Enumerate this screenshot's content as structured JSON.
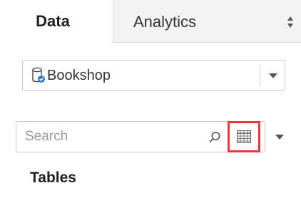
{
  "tabs": {
    "data_label": "Data",
    "analytics_label": "Analytics"
  },
  "data_source": {
    "selected": "Bookshop",
    "icon": "database-icon"
  },
  "search": {
    "placeholder": "Search",
    "value": ""
  },
  "tables": {
    "heading": "Tables"
  },
  "colors": {
    "highlight": "#e03a3a",
    "inactive_tab": "#f3f3f3",
    "db_badge": "#2b7bc8"
  }
}
